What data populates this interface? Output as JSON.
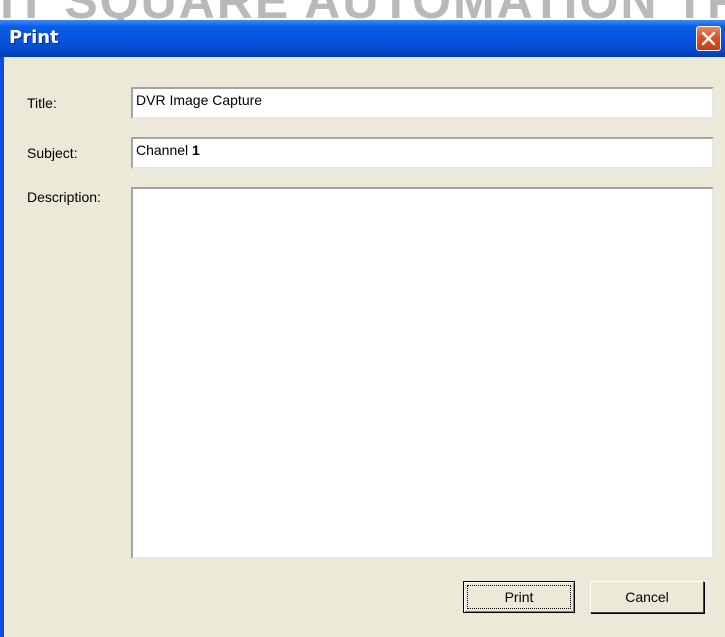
{
  "banner": {
    "text": "IT SQUARE AUTOMATION TRA"
  },
  "window": {
    "title": "Print",
    "close_icon": "close-icon"
  },
  "form": {
    "title_label": "Title:",
    "title_value": "DVR Image Capture",
    "subject_label": "Subject:",
    "subject_value_prefix": "Channel ",
    "subject_value_bold": "1",
    "description_label": "Description:",
    "description_value": ""
  },
  "buttons": {
    "print_label": "Print",
    "cancel_label": "Cancel"
  },
  "colors": {
    "titlebar": "#0553dd",
    "client": "#ece9d8",
    "close_button": "#d8542c"
  }
}
